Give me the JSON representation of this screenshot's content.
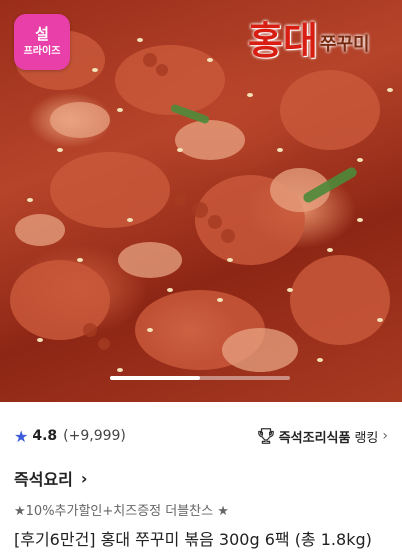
{
  "badge": {
    "line1": "설",
    "line2": "프라이즈"
  },
  "brand": {
    "main": "홍대",
    "sub": "쭈꾸미"
  },
  "gallery": {
    "progress": 0.5
  },
  "rating": {
    "score": "4.8",
    "count": "(+9,999)"
  },
  "ranking": {
    "category": "즉석조리식품",
    "label": "랭킹",
    "chevron": "›"
  },
  "category": {
    "label": "즉석요리",
    "arrow": "›"
  },
  "promo": "★10%추가할인+치즈증정 더블찬스 ★",
  "product_title": "[후기6만건] 홍대 쭈꾸미 볶음 300g 6팩 (총 1.8kg)",
  "colors": {
    "badge": "#e83fa8",
    "star": "#3b5bdb",
    "brand_red": "#d81e12"
  },
  "icons": {
    "rating": "star-icon",
    "ranking": "trophy-icon",
    "more": "chevron-right-icon"
  }
}
